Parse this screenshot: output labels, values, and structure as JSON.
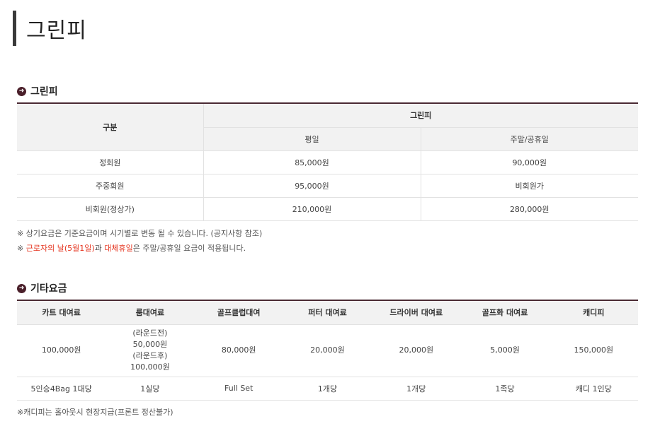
{
  "page": {
    "title": "그린피"
  },
  "green_fee": {
    "heading": "그린피",
    "header": {
      "category": "구분",
      "group": "그린피",
      "weekday": "평일",
      "weekend": "주말/공휴일"
    },
    "rows": [
      {
        "type": "정회원",
        "weekday": "85,000원",
        "weekend": "90,000원"
      },
      {
        "type": "주중회원",
        "weekday": "95,000원",
        "weekend": "비회원가"
      },
      {
        "type": "비회원(정상가)",
        "weekday": "210,000원",
        "weekend": "280,000원"
      }
    ],
    "notes": {
      "line1": "※ 상기요금은 기준요금이며 시기별로 변동 될 수 있습니다. (공지사항 참조)",
      "line2_prefix": "※ ",
      "line2_red1": "근로자의 날(5월1일)",
      "line2_mid": "과 ",
      "line2_red2": "대체휴일",
      "line2_suffix": "은 주말/공휴일 요금이 적용됩니다."
    }
  },
  "other_fees": {
    "heading": "기타요금",
    "headers": [
      "카트 대여료",
      "룸대여료",
      "골프클럽대여",
      "퍼터 대여료",
      "드라이버 대여료",
      "골프화 대여료",
      "캐디피"
    ],
    "prices": {
      "cart": "100,000원",
      "room_line1": "(라운드전)",
      "room_line2": "50,000원",
      "room_line3": "(라운드후)",
      "room_line4": "100,000원",
      "club": "80,000원",
      "putter": "20,000원",
      "driver": "20,000원",
      "shoes": "5,000원",
      "caddie": "150,000원"
    },
    "units": [
      "5인승4Bag 1대당",
      "1실당",
      "Full Set",
      "1개당",
      "1개당",
      "1족당",
      "캐디 1인당"
    ],
    "note": "※캐디피는 홀아웃시 현장지급(프론트 정산불가)"
  },
  "colors": {
    "accent": "#4a2a33",
    "highlight": "#e5341f",
    "header_bg": "#f2f2f2"
  },
  "icons": {
    "section_bullet": "arrow-right-circle-icon"
  }
}
